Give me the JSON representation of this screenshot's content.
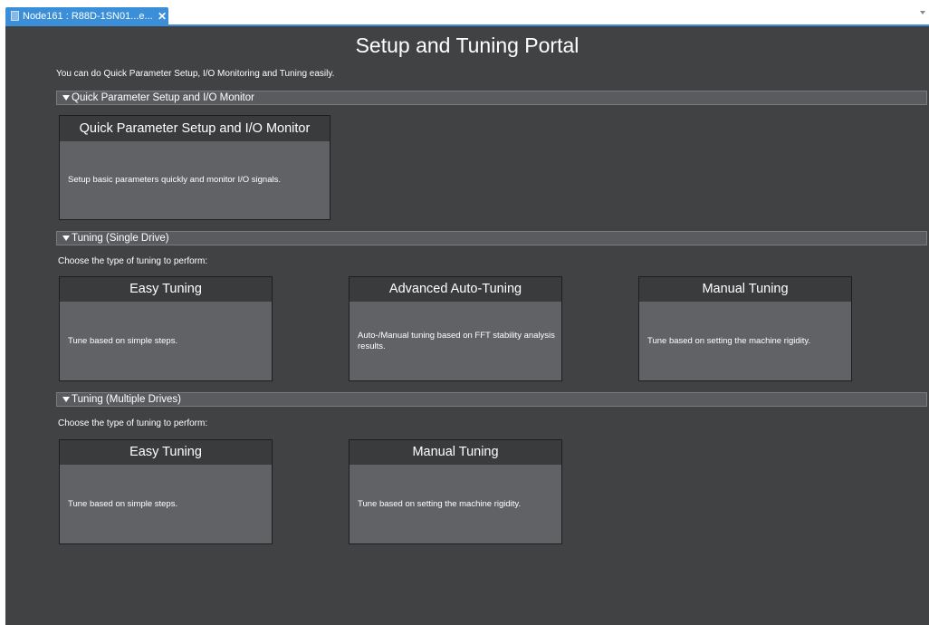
{
  "tab": {
    "label": "Node161 : R88D-1SN01...e...",
    "close": "✕"
  },
  "portal": {
    "title": "Setup and Tuning Portal",
    "intro": "You can do Quick Parameter Setup, I/O Monitoring and Tuning easily."
  },
  "sections": [
    {
      "header": "Quick Parameter Setup and I/O Monitor",
      "cards": [
        {
          "title": "Quick Parameter Setup and I/O Monitor",
          "description": "Setup basic parameters quickly and monitor I/O signals."
        }
      ]
    },
    {
      "header": "Tuning (Single Drive)",
      "prompt": "Choose the type of tuning to perform:",
      "cards": [
        {
          "title": "Easy Tuning",
          "description": "Tune based on simple steps."
        },
        {
          "title": "Advanced Auto-Tuning",
          "description": "Auto-/Manual tuning based on FFT stability analysis results."
        },
        {
          "title": "Manual Tuning",
          "description": "Tune based on setting the machine rigidity."
        }
      ]
    },
    {
      "header": "Tuning (Multiple Drives)",
      "prompt": "Choose the type of tuning to perform:",
      "cards": [
        {
          "title": "Easy Tuning",
          "description": "Tune based on simple steps."
        },
        {
          "title": "Manual Tuning",
          "description": "Tune based on setting the machine rigidity."
        }
      ]
    }
  ],
  "colors": {
    "tab_blue": "#3b8fd8",
    "pane_bg": "#414244",
    "card_bg": "#616265",
    "card_header_bg": "#3a3b3d",
    "section_header_bg": "#595b5e"
  },
  "icons": {
    "tab_icon": "document-node-icon",
    "section_arrow": "triangle-down-icon"
  }
}
